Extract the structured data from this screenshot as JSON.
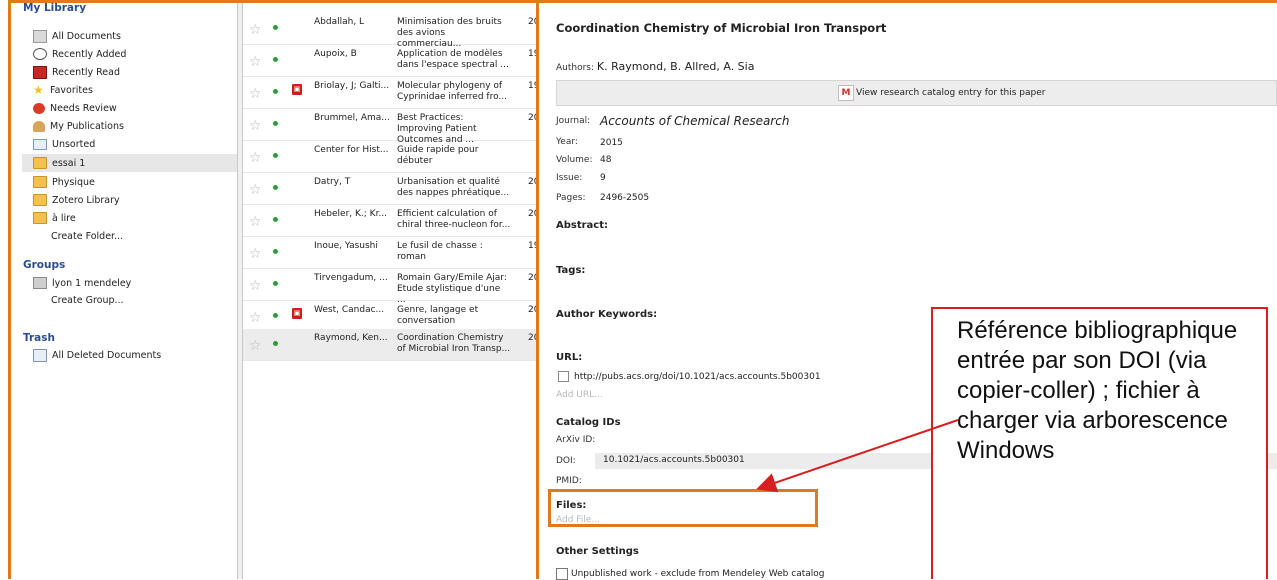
{
  "sidebar": {
    "my_library_title": "My Library",
    "items": [
      {
        "label": "All Documents",
        "icon": "all-documents-icon"
      },
      {
        "label": "Recently Added",
        "icon": "clock-icon"
      },
      {
        "label": "Recently Read",
        "icon": "book-icon"
      },
      {
        "label": "Favorites",
        "icon": "star-icon"
      },
      {
        "label": "Needs Review",
        "icon": "needs-review-icon"
      },
      {
        "label": "My Publications",
        "icon": "person-icon"
      },
      {
        "label": "Unsorted",
        "icon": "unsorted-icon"
      },
      {
        "label": "essai 1",
        "icon": "folder-icon"
      },
      {
        "label": "Physique",
        "icon": "folder-icon"
      },
      {
        "label": "Zotero Library",
        "icon": "folder-icon"
      },
      {
        "label": "à lire",
        "icon": "folder-icon"
      }
    ],
    "create_folder": "Create Folder...",
    "groups_title": "Groups",
    "group_item": "lyon 1 mendeley",
    "create_group": "Create Group...",
    "trash_title": "Trash",
    "trash_item": "All Deleted Documents"
  },
  "documents": [
    {
      "author": "Abdallah, L",
      "title": "Minimisation des bruits des avions commerciau...",
      "year": "20",
      "pdf": false
    },
    {
      "author": "Aupoix, B",
      "title": "Application de modèles dans l'espace spectral ...",
      "year": "19",
      "pdf": false
    },
    {
      "author": "Briolay, J; Galti...",
      "title": "Molecular phylogeny of Cyprinidae inferred fro...",
      "year": "19",
      "pdf": true
    },
    {
      "author": "Brummel, Ama...",
      "title": "Best Practices: Improving Patient Outcomes and ...",
      "year": "20",
      "pdf": false
    },
    {
      "author": "Center for Hist...",
      "title": "Guide rapide pour débuter",
      "year": "",
      "pdf": false
    },
    {
      "author": "Datry, T",
      "title": "Urbanisation et qualité des nappes phréatique...",
      "year": "20",
      "pdf": false
    },
    {
      "author": "Hebeler, K.; Kr...",
      "title": "Efficient calculation of chiral three-nucleon for...",
      "year": "20",
      "pdf": false
    },
    {
      "author": "Inoue, Yasushi",
      "title": "Le fusil de chasse : roman",
      "year": "19",
      "pdf": false
    },
    {
      "author": "Tirvengadum, ...",
      "title": "Romain Gary/Emile Ajar: Etude stylistique d'une ...",
      "year": "20",
      "pdf": false
    },
    {
      "author": "West, Candac...",
      "title": "Genre, langage et conversation",
      "year": "20",
      "pdf": true
    },
    {
      "author": "Raymond, Ken...",
      "title": "Coordination Chemistry of Microbial Iron Transp...",
      "year": "20",
      "pdf": false
    }
  ],
  "details": {
    "title": "Coordination Chemistry of Microbial Iron Transport",
    "authors_label": "Authors:",
    "authors": "K. Raymond, B. Allred, A. Sia",
    "catalog_button": "View research catalog entry for this paper",
    "journal_label": "Journal:",
    "journal": "Accounts of Chemical Research",
    "year_label": "Year:",
    "year": "2015",
    "volume_label": "Volume:",
    "volume": "48",
    "issue_label": "Issue:",
    "issue": "9",
    "pages_label": "Pages:",
    "pages": "2496-2505",
    "abstract_head": "Abstract:",
    "tags_head": "Tags:",
    "keywords_head": "Author Keywords:",
    "url_head": "URL:",
    "url": "http://pubs.acs.org/doi/10.1021/acs.accounts.5b00301",
    "add_url": "Add URL...",
    "catalog_ids_head": "Catalog IDs",
    "arxiv_label": "ArXiv ID:",
    "doi_label": "DOI:",
    "doi": "10.1021/acs.accounts.5b00301",
    "pmid_label": "PMID:",
    "files_head": "Files:",
    "add_file": "Add File...",
    "other_settings_head": "Other Settings",
    "unpublished_label": "Unpublished work - exclude from Mendeley Web catalog"
  },
  "annotation": {
    "callout_text": "Référence bibliographique entrée par son DOI (via copier-coller) ; fichier à charger via arborescence Windows",
    "frame_color": "#E07A1F",
    "arrow_color": "#d61f1f"
  }
}
